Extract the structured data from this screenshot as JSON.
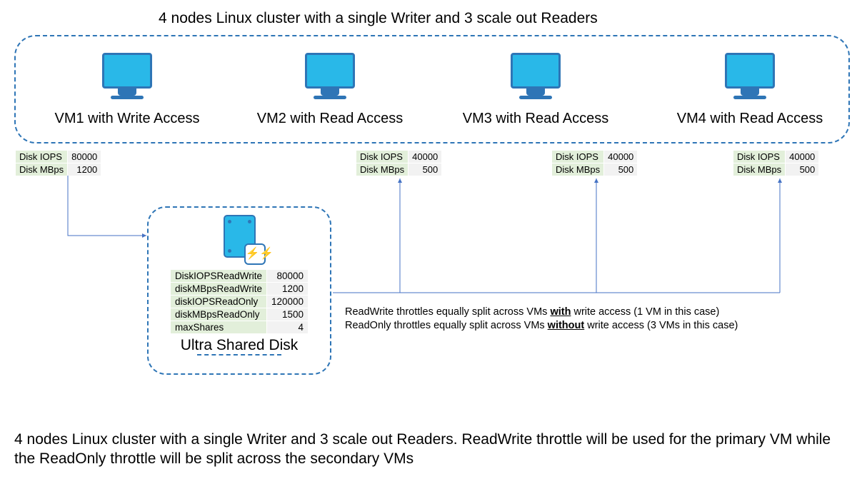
{
  "title": "4 nodes Linux cluster with a single Writer and 3 scale out Readers",
  "vms": {
    "vm1": {
      "label": "VM1 with Write Access",
      "iops_label": "Disk IOPS",
      "iops": "80000",
      "mbps_label": "Disk MBps",
      "mbps": "1200"
    },
    "vm2": {
      "label": "VM2 with Read Access",
      "iops_label": "Disk IOPS",
      "iops": "40000",
      "mbps_label": "Disk MBps",
      "mbps": "500"
    },
    "vm3": {
      "label": "VM3 with Read Access",
      "iops_label": "Disk IOPS",
      "iops": "40000",
      "mbps_label": "Disk MBps",
      "mbps": "500"
    },
    "vm4": {
      "label": "VM4 with Read Access",
      "iops_label": "Disk IOPS",
      "iops": "40000",
      "mbps_label": "Disk MBps",
      "mbps": "500"
    }
  },
  "disk": {
    "label": "Ultra Shared Disk",
    "rows": {
      "r1": {
        "k": "DiskIOPSReadWrite",
        "v": "80000"
      },
      "r2": {
        "k": "diskMBpsReadWrite",
        "v": "1200"
      },
      "r3": {
        "k": "diskIOPSReadOnly",
        "v": "120000"
      },
      "r4": {
        "k": "diskMBpsReadOnly",
        "v": "1500"
      },
      "r5": {
        "k": "maxShares",
        "v": "4"
      }
    }
  },
  "note": {
    "l1a": "ReadWrite throttles equally split across VMs ",
    "l1b": "with",
    "l1c": " write access (1 VM in this case)",
    "l2a": "ReadOnly throttles equally split across VMs ",
    "l2b": "without",
    "l2c": " write access (3 VMs in this case)"
  },
  "caption": "4 nodes Linux cluster with a single Writer and 3 scale out Readers. ReadWrite throttle will be used for the primary VM while the ReadOnly throttle will be split across the secondary VMs",
  "chart_data": {
    "type": "table",
    "title": "Shared disk throttle allocation across 4 VMs",
    "vm_allocation": [
      {
        "vm": "VM1",
        "access": "Write",
        "disk_iops": 80000,
        "disk_mbps": 1200
      },
      {
        "vm": "VM2",
        "access": "Read",
        "disk_iops": 40000,
        "disk_mbps": 500
      },
      {
        "vm": "VM3",
        "access": "Read",
        "disk_iops": 40000,
        "disk_mbps": 500
      },
      {
        "vm": "VM4",
        "access": "Read",
        "disk_iops": 40000,
        "disk_mbps": 500
      }
    ],
    "disk_properties": {
      "DiskIOPSReadWrite": 80000,
      "diskMBpsReadWrite": 1200,
      "diskIOPSReadOnly": 120000,
      "diskMBpsReadOnly": 1500,
      "maxShares": 4
    }
  }
}
